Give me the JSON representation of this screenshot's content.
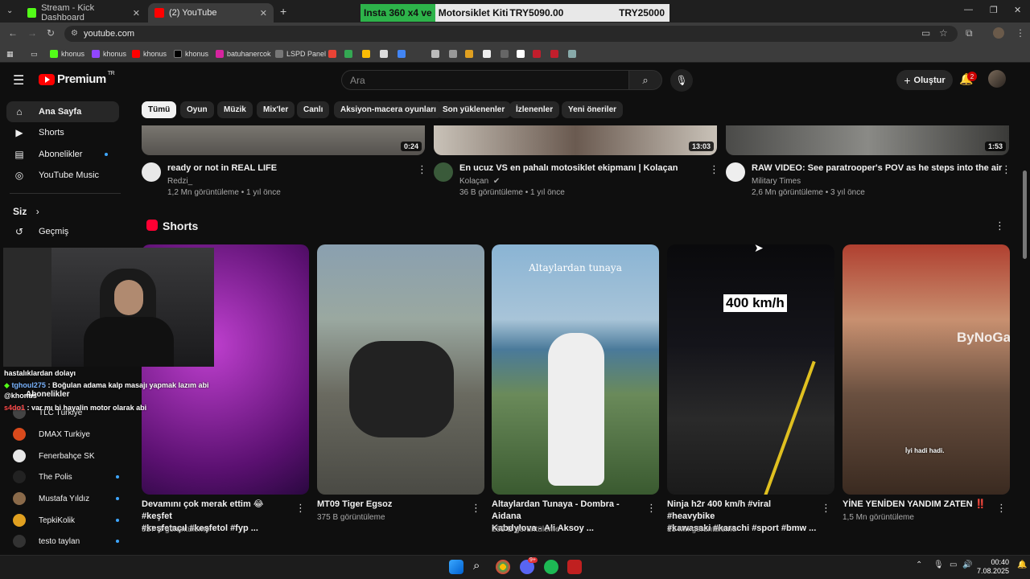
{
  "browser": {
    "tabs": [
      {
        "label": "Stream - Kick Dashboard",
        "color": "#53fc18"
      },
      {
        "label": "(2) YouTube",
        "color": "#ff0000"
      }
    ],
    "new_tab": "+",
    "url": "youtube.com",
    "bookmarks": [
      "khonus",
      "khonus",
      "khonus",
      "khonus",
      "batuhanercok",
      "LSPD Panel"
    ]
  },
  "ticker": {
    "text_green": "Insta 360 x4 ve",
    "text_main": "Motorsiklet Kiti",
    "price_current": "TRY5090.00",
    "price_goal": "TRY25000"
  },
  "header": {
    "logo": "Premium",
    "logo_sup": "TR",
    "search_placeholder": "Ara",
    "create_label": "Oluştur",
    "notif_count": "2"
  },
  "sidebar": {
    "items": [
      {
        "label": "Ana Sayfa",
        "icon": "home-icon"
      },
      {
        "label": "Shorts",
        "icon": "shorts-icon"
      },
      {
        "label": "Abonelikler",
        "icon": "subscriptions-icon"
      },
      {
        "label": "YouTube Music",
        "icon": "music-icon"
      }
    ],
    "you_label": "Siz",
    "history_label": "Geçmiş",
    "subs_heading": "Abonelikler",
    "channels": [
      {
        "name": "TLC Türkiye",
        "color": "#444"
      },
      {
        "name": "DMAX Turkiye",
        "color": "#d94a1c"
      },
      {
        "name": "Fenerbahçe SK",
        "color": "#e8e8e8"
      },
      {
        "name": "The Polis",
        "color": "#222"
      },
      {
        "name": "Mustafa Yıldız",
        "color": "#8a6a4a"
      },
      {
        "name": "TepkiKolik",
        "color": "#e0a020"
      },
      {
        "name": "testo taylan",
        "color": "#333"
      }
    ]
  },
  "chips": [
    "Tümü",
    "Oyun",
    "Müzik",
    "Mix'ler",
    "Canlı",
    "Aksiyon-macera oyunları",
    "Son yüklenenler",
    "İzlenenler",
    "Yeni öneriler"
  ],
  "videos": [
    {
      "title": "ready or not in REAL LIFE",
      "channel": "Redzi_",
      "meta": "1,2 Mn görüntüleme • 1 yıl önce",
      "duration": "0:24"
    },
    {
      "title": "En ucuz VS en pahalı motosiklet ekipmanı | Kolaçan",
      "channel": "Kolaçan",
      "meta": "36 B görüntüleme • 1 yıl önce",
      "duration": "13:03"
    },
    {
      "title": "RAW VIDEO: See paratrooper's POV as he steps into the air",
      "channel": "Military Times",
      "meta": "2,6 Mn görüntüleme • 3 yıl önce",
      "duration": "1:53"
    }
  ],
  "shorts_heading": "Shorts",
  "shorts": [
    {
      "title1": "Devamını çok merak ettim 😂 #keşfet",
      "title2": "#keşfetaçıl #keşfetol #fyp ...",
      "views": "537 B görüntüleme"
    },
    {
      "title1": "MT09 Tiger Egsoz",
      "title2": "",
      "views": "375 B görüntüleme"
    },
    {
      "title1": "Altaylardan Tunaya - Dombra - Aidana",
      "title2": "Kabdylova - Ali Aksoy ...",
      "views": "269 B görüntüleme",
      "overlay": "Altaylardan tunaya"
    },
    {
      "title1": "Ninja h2r 400 km/h #viral #heavybike",
      "title2": "#kawasaki #karachi #sport #bmw ...",
      "views": "13 Mn görüntüleme",
      "overlay": "400 km/h"
    },
    {
      "title1": "YİNE YENİDEN YANDIM ZATEN ‼️",
      "title2": "",
      "views": "1,5 Mn görüntüleme",
      "overlay": "İyi hadi hadi.",
      "overlay2": "ByNoGame"
    }
  ],
  "chat": [
    {
      "user": "",
      "text": "hastalıklardan dolayı"
    },
    {
      "user": "tghoul275",
      "text": ": Boğulan adama kalp masajı yapmak lazım abi"
    },
    {
      "user": "",
      "text": "@khonus"
    },
    {
      "user": "s4do1",
      "text": ": var mı bi hayalin motor olarak abi"
    }
  ],
  "taskbar": {
    "time": "00:40",
    "date": "7.08.2025",
    "discord_badge": "9+"
  }
}
